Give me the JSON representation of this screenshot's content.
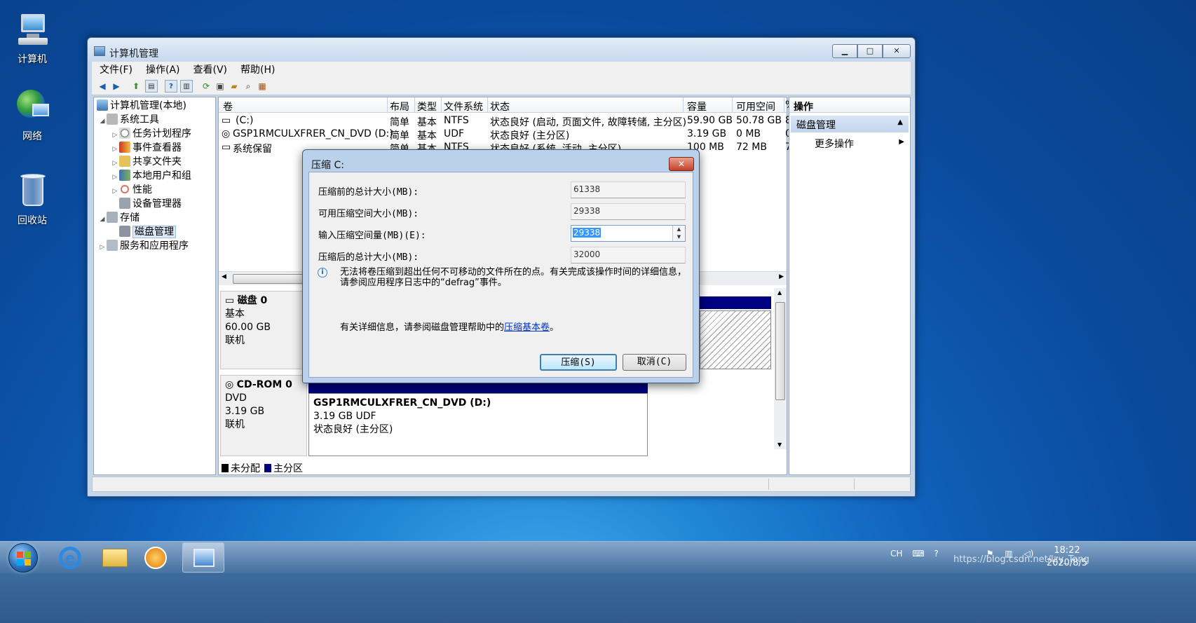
{
  "desktop": {
    "icons": [
      {
        "label": "计算机",
        "icon": "computer-icon"
      },
      {
        "label": "网络",
        "icon": "network-icon"
      },
      {
        "label": "回收站",
        "icon": "recycle-bin-icon"
      }
    ]
  },
  "window": {
    "title": "计算机管理",
    "controls": {
      "minimize": "▁",
      "maximize": "□",
      "close": "✕"
    }
  },
  "menu": {
    "items": [
      "文件(F)",
      "操作(A)",
      "查看(V)",
      "帮助(H)"
    ]
  },
  "tree": {
    "root": "计算机管理(本地)",
    "items": [
      {
        "label": "系统工具",
        "expander": "◢",
        "icon": "tools-icon"
      },
      {
        "label": "任务计划程序",
        "expander": "▷",
        "icon": "clock-icon"
      },
      {
        "label": "事件查看器",
        "expander": "▷",
        "icon": "event-viewer-icon"
      },
      {
        "label": "共享文件夹",
        "expander": "▷",
        "icon": "shared-folder-icon"
      },
      {
        "label": "本地用户和组",
        "expander": "▷",
        "icon": "users-icon"
      },
      {
        "label": "性能",
        "expander": "▷",
        "icon": "performance-icon"
      },
      {
        "label": "设备管理器",
        "expander": "",
        "icon": "device-manager-icon"
      },
      {
        "label": "存储",
        "expander": "◢",
        "icon": "storage-icon"
      },
      {
        "label": "磁盘管理",
        "expander": "",
        "icon": "disk-management-icon"
      },
      {
        "label": "服务和应用程序",
        "expander": "▷",
        "icon": "services-icon"
      }
    ]
  },
  "volumes": {
    "columns": [
      "卷",
      "布局",
      "类型",
      "文件系统",
      "状态",
      "容量",
      "可用空间",
      "%"
    ],
    "rows": [
      {
        "vol": "(C:)",
        "layout": "简单",
        "type": "基本",
        "fs": "NTFS",
        "status": "状态良好 (启动, 页面文件, 故障转储, 主分区)",
        "capacity": "59.90 GB",
        "free": "50.78 GB",
        "pct": "8"
      },
      {
        "vol": "GSP1RMCULXFRER_CN_DVD (D:)",
        "layout": "简单",
        "type": "基本",
        "fs": "UDF",
        "status": "状态良好 (主分区)",
        "capacity": "3.19 GB",
        "free": "0 MB",
        "pct": "0"
      },
      {
        "vol": "系统保留",
        "layout": "简单",
        "type": "基本",
        "fs": "NTFS",
        "status": "状态良好 (系统, 活动, 主分区)",
        "capacity": "100 MB",
        "free": "72 MB",
        "pct": "7"
      }
    ]
  },
  "disks": {
    "disk0": {
      "name": "磁盘 0",
      "type": "基本",
      "size": "60.00 GB",
      "state": "联机"
    },
    "cdrom0": {
      "name": "CD-ROM 0",
      "type": "DVD",
      "size": "3.19 GB",
      "state": "联机",
      "partition": {
        "name": "GSP1RMCULXFRER_CN_DVD  (D:)",
        "size": "3.19 GB UDF",
        "status": "状态良好 (主分区)"
      }
    }
  },
  "legend": {
    "unallocated": "未分配",
    "primary": "主分区",
    "unallocated_color": "#000000",
    "primary_color": "#000080"
  },
  "actions": {
    "header": "操作",
    "section": "磁盘管理",
    "more": "更多操作"
  },
  "dialog": {
    "title": "压缩 C:",
    "close": "✕",
    "fields": {
      "total_before_label": "压缩前的总计大小(MB):",
      "total_before_value": "61338",
      "available_label": "可用压缩空间大小(MB):",
      "available_value": "29338",
      "input_label": "输入压缩空间量(MB)(E):",
      "input_value": "29338",
      "total_after_label": "压缩后的总计大小(MB):",
      "total_after_value": "32000"
    },
    "info": "无法将卷压缩到超出任何不可移动的文件所在的点。有关完成该操作时间的详细信息，请参阅应用程序日志中的“defrag”事件。",
    "help_prefix": "有关详细信息，请参阅磁盘管理帮助中的",
    "help_link": "压缩基本卷",
    "help_suffix": "。",
    "buttons": {
      "shrink": "压缩(S)",
      "cancel": "取消(C)"
    }
  },
  "taskbar": {
    "tray": {
      "lang": "CH"
    },
    "clock": {
      "time": "18:22",
      "date": "2020/8/5"
    },
    "watermark": "https://blog.csdn.net/lzy_Tong"
  }
}
